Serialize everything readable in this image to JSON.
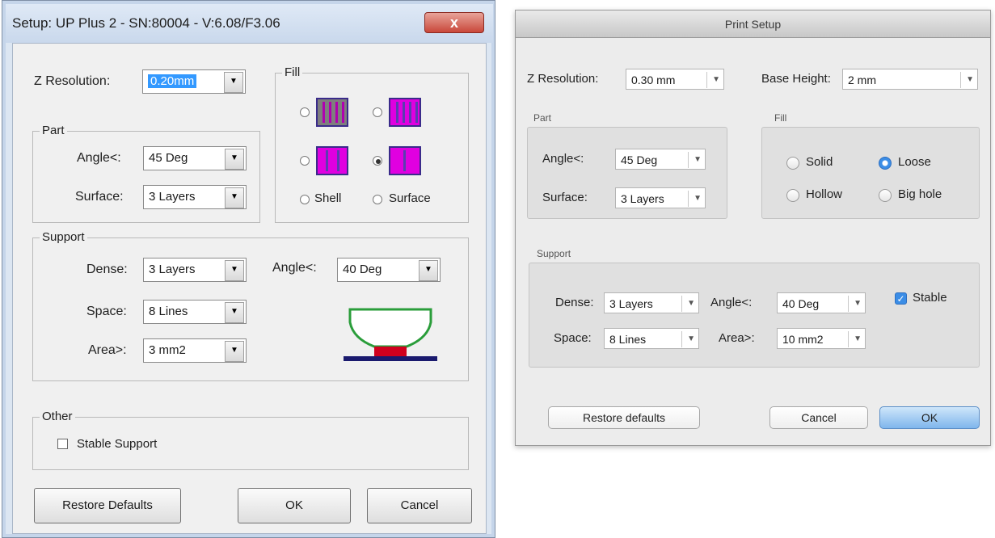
{
  "windows_dialog": {
    "title": "Setup: UP Plus 2 - SN:80004 - V:6.08/F3.06",
    "close_glyph": "x",
    "z_resolution": {
      "label": "Z Resolution:",
      "value": "0.20mm"
    },
    "part": {
      "title": "Part",
      "angle": {
        "label": "Angle<:",
        "value": "45 Deg"
      },
      "surface": {
        "label": "Surface:",
        "value": "3 Layers"
      }
    },
    "fill": {
      "title": "Fill",
      "selected_index": 3,
      "shell_label": "Shell",
      "surface_label": "Surface"
    },
    "support": {
      "title": "Support",
      "dense": {
        "label": "Dense:",
        "value": "3 Layers"
      },
      "space": {
        "label": "Space:",
        "value": "8 Lines"
      },
      "area": {
        "label": "Area>:",
        "value": "3 mm2"
      },
      "angle": {
        "label": "Angle<:",
        "value": "40 Deg"
      }
    },
    "other": {
      "title": "Other",
      "stable_support": {
        "label": "Stable Support",
        "checked": false
      }
    },
    "buttons": {
      "restore": "Restore Defaults",
      "ok": "OK",
      "cancel": "Cancel"
    }
  },
  "mac_dialog": {
    "title": "Print Setup",
    "z_resolution": {
      "label": "Z Resolution:",
      "value": "0.30 mm"
    },
    "base_height": {
      "label": "Base Height:",
      "value": "2 mm"
    },
    "part": {
      "title": "Part",
      "angle": {
        "label": "Angle<:",
        "value": "45 Deg"
      },
      "surface": {
        "label": "Surface:",
        "value": "3 Layers"
      }
    },
    "fill": {
      "title": "Fill",
      "options": [
        "Solid",
        "Loose",
        "Hollow",
        "Big hole"
      ],
      "selected": "Loose"
    },
    "support": {
      "title": "Support",
      "dense": {
        "label": "Dense:",
        "value": "3 Layers"
      },
      "space": {
        "label": "Space:",
        "value": "8 Lines"
      },
      "angle": {
        "label": "Angle<:",
        "value": "40 Deg"
      },
      "area": {
        "label": "Area>:",
        "value": "10 mm2"
      },
      "stable": {
        "label": "Stable",
        "checked": true
      }
    },
    "buttons": {
      "restore": "Restore defaults",
      "cancel": "Cancel",
      "ok": "OK"
    }
  },
  "colors": {
    "fill_magenta": "#e000e0",
    "support_red": "#d0001e",
    "base_navy": "#1a1a6e",
    "part_green": "#2a9d3a",
    "selection_blue": "#3399ff",
    "mac_accent": "#3b8de6"
  }
}
